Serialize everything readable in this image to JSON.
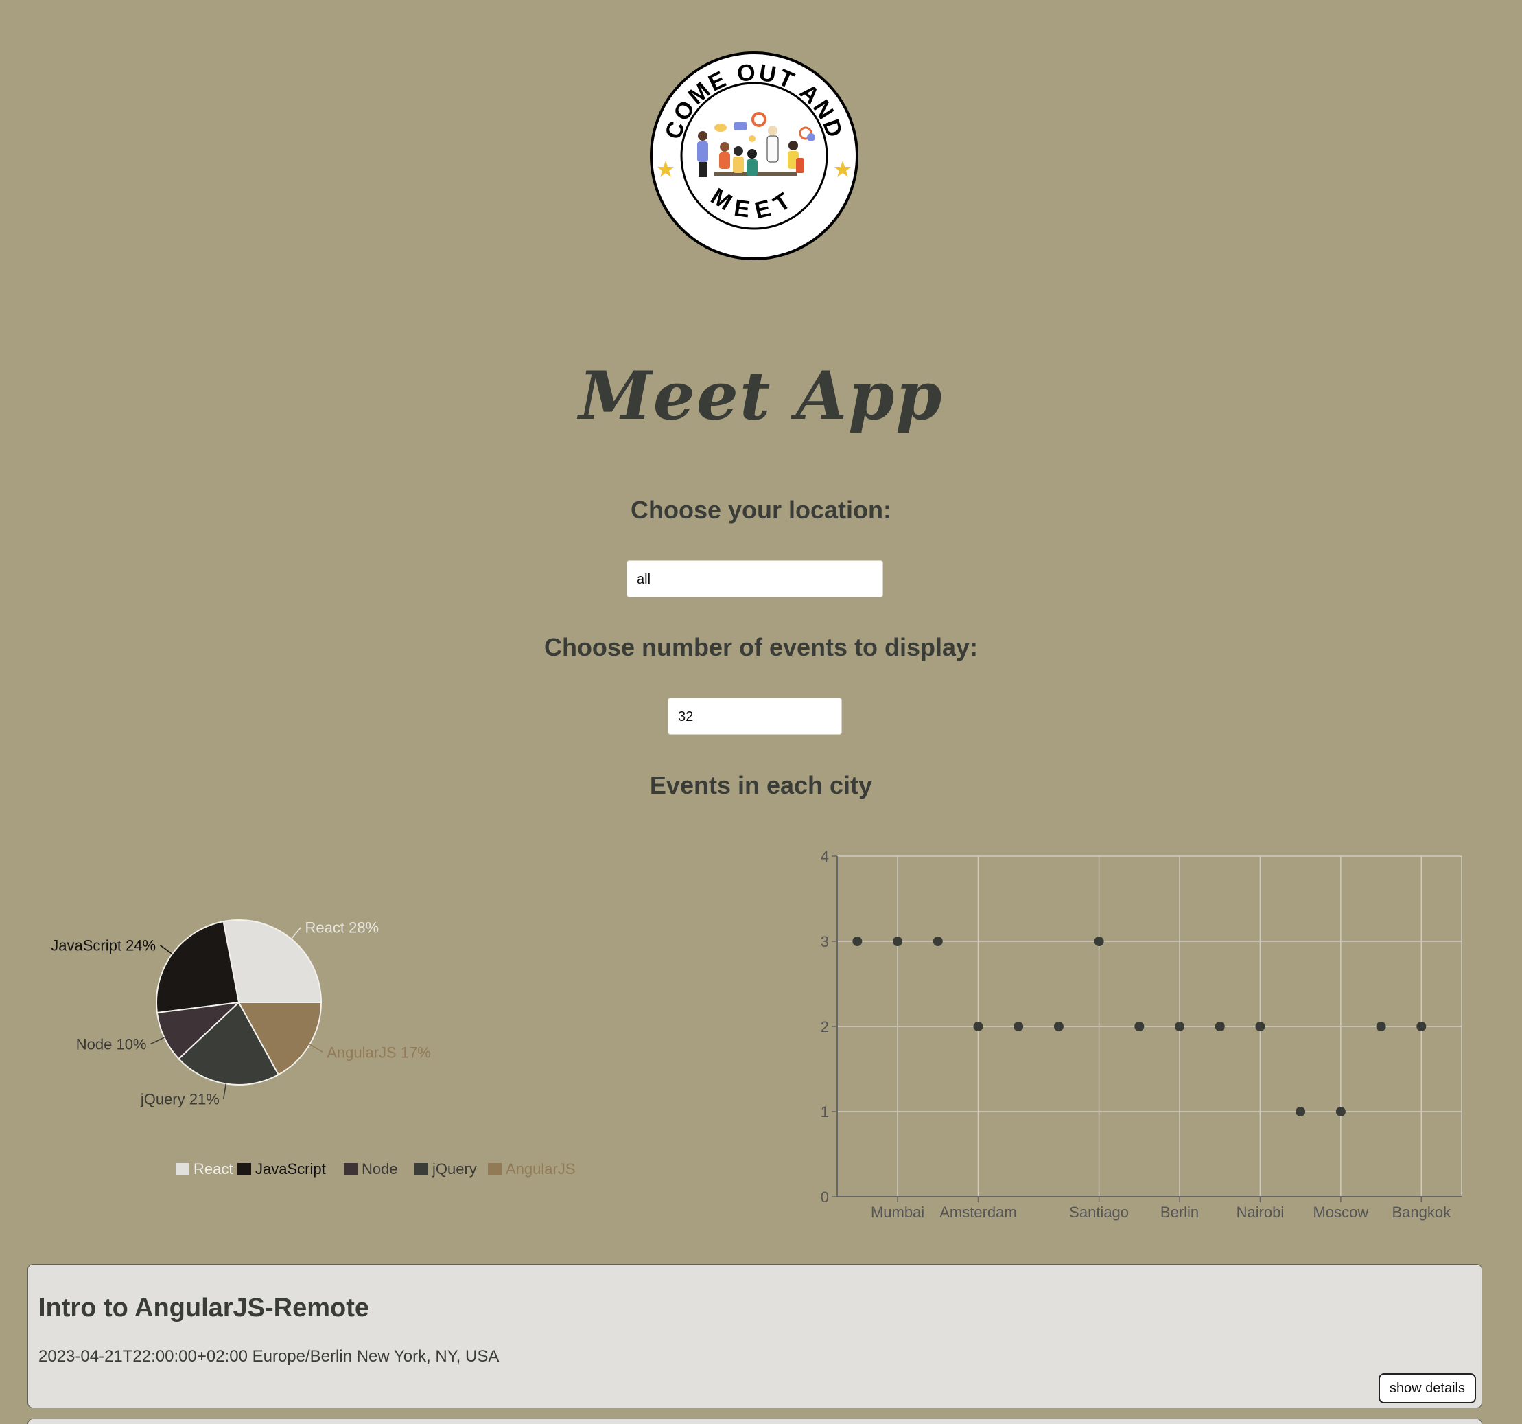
{
  "header": {
    "logo_top_text": "COME OUT AND",
    "logo_bottom_text": "MEET",
    "app_title": "Meet App"
  },
  "city_search": {
    "label": "Choose your location:",
    "value": "all"
  },
  "number_of_events": {
    "label": "Choose number of events to display:",
    "value": "32"
  },
  "charts_heading": "Events in each city",
  "chart_data": [
    {
      "type": "pie",
      "slices": [
        {
          "label": "React",
          "percent": 28,
          "color": "#e1e0dc"
        },
        {
          "label": "JavaScript",
          "percent": 24,
          "color": "#1a1715"
        },
        {
          "label": "Node",
          "percent": 10,
          "color": "#3e3437"
        },
        {
          "label": "jQuery",
          "percent": 21,
          "color": "#3b3e38"
        },
        {
          "label": "AngularJS",
          "percent": 17,
          "color": "#937a56"
        }
      ],
      "slice_labels": [
        "React 28%",
        "JavaScript 24%",
        "Node 10%",
        "jQuery 21%",
        "AngularJS 17%"
      ],
      "legend": [
        "React",
        "JavaScript",
        "Node",
        "jQuery",
        "AngularJS"
      ],
      "legend_placement": "bottom"
    },
    {
      "type": "scatter",
      "x_tick_labels": [
        "Mumbai",
        "Amsterdam",
        "Santiago",
        "Berlin",
        "Nairobi",
        "Moscow",
        "Bangkok"
      ],
      "points": [
        {
          "x_index": 0,
          "y": 3
        },
        {
          "x_index": 1,
          "y": 3
        },
        {
          "x_index": 2,
          "y": 3
        },
        {
          "x_index": 3,
          "y": 2
        },
        {
          "x_index": 4,
          "y": 2
        },
        {
          "x_index": 5,
          "y": 2
        },
        {
          "x_index": 6,
          "y": 3
        },
        {
          "x_index": 7,
          "y": 2
        },
        {
          "x_index": 8,
          "y": 2
        },
        {
          "x_index": 9,
          "y": 2
        },
        {
          "x_index": 10,
          "y": 2
        },
        {
          "x_index": 11,
          "y": 1
        },
        {
          "x_index": 12,
          "y": 1
        },
        {
          "x_index": 13,
          "y": 2
        },
        {
          "x_index": 14,
          "y": 2
        }
      ],
      "x_tick_positions": [
        1,
        3,
        6,
        8,
        10,
        12,
        14
      ],
      "x_domain": [
        -0.5,
        15
      ],
      "y_ticks": [
        0,
        1,
        2,
        3,
        4
      ],
      "ylim": [
        0,
        4
      ],
      "grid": true
    }
  ],
  "events": [
    {
      "title": "Intro to AngularJS-Remote",
      "start": "2023-04-21T22:00:00+02:00",
      "timezone": "Europe/Berlin",
      "location": "New York, NY, USA",
      "button_label": "show details"
    }
  ],
  "colors": {
    "background": "#a89f81",
    "card": "#e1e0dc",
    "text": "#3a3d37"
  }
}
